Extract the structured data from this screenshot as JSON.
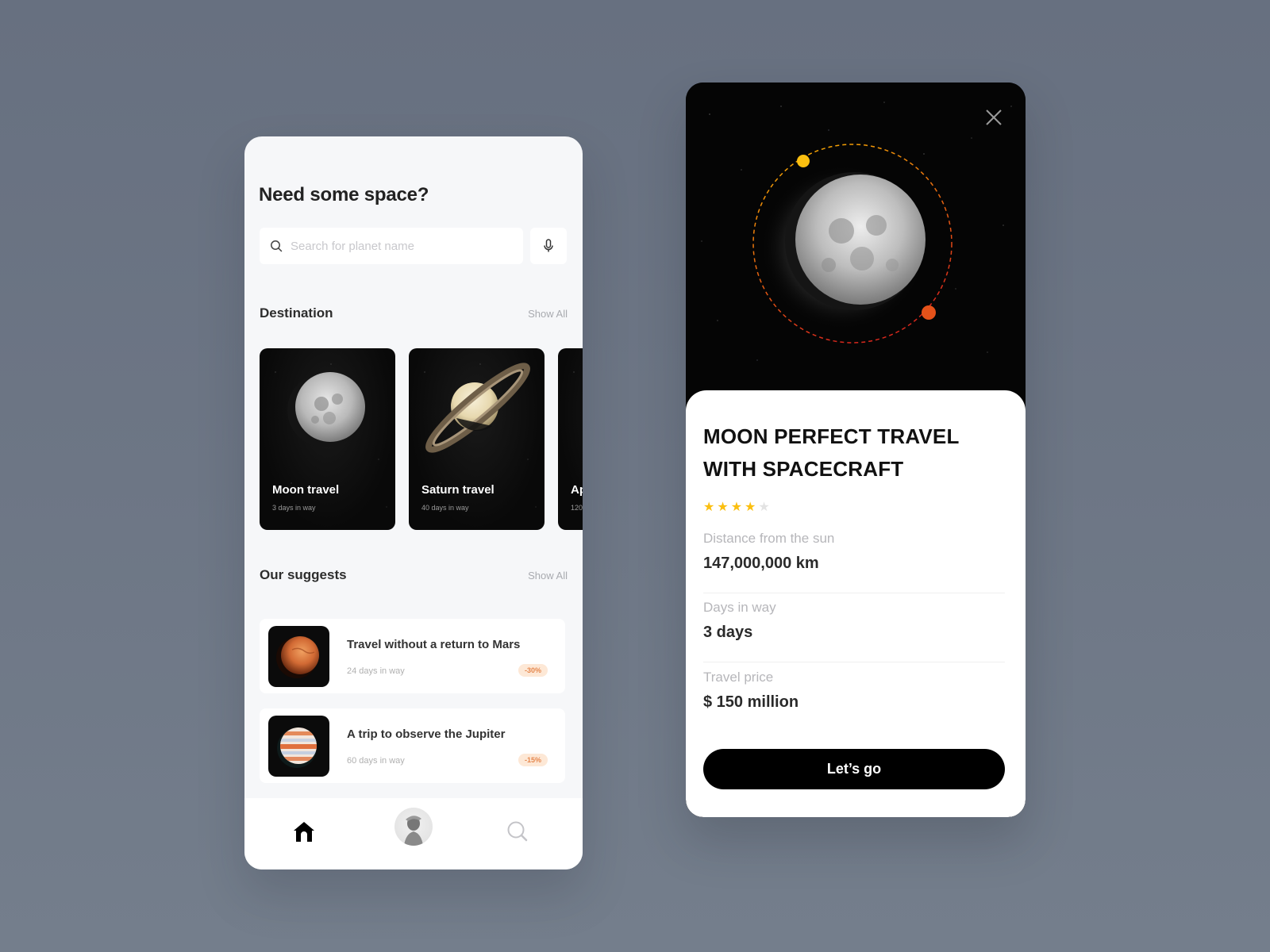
{
  "colors": {
    "background": "#6d7685",
    "star_filled": "#fbbf10",
    "star_empty": "#e3e3e3",
    "badge_bg": "#fde8d6",
    "badge_text": "#e5874e",
    "orbit_start": "#f8b400",
    "orbit_end": "#e0451a"
  },
  "home": {
    "title": "Need some space?",
    "search": {
      "placeholder": "Search for planet name",
      "value": ""
    },
    "icons": {
      "search": "search-icon",
      "mic": "microphone-icon"
    },
    "destination": {
      "heading": "Destination",
      "show_all": "Show All",
      "cards": [
        {
          "name": "Moon travel",
          "sub": "3 days in way",
          "image": "moon"
        },
        {
          "name": "Saturn travel",
          "sub": "40 days in way",
          "image": "saturn"
        },
        {
          "name": "Ap",
          "sub": "120",
          "image": "planet"
        }
      ]
    },
    "suggests": {
      "heading": "Our suggests",
      "show_all": "Show All",
      "items": [
        {
          "title": "Travel without a return to Mars",
          "sub": "24 days in way",
          "badge": "-30%",
          "image": "mars"
        },
        {
          "title": "A trip to observe the Jupiter",
          "sub": "60 days in way",
          "badge": "-15%",
          "image": "jupiter"
        }
      ]
    },
    "tabbar": {
      "items": [
        {
          "name": "home",
          "icon": "home-icon",
          "active": true
        },
        {
          "name": "profile",
          "icon": "avatar",
          "active": false
        },
        {
          "name": "search",
          "icon": "search-icon",
          "active": false
        }
      ]
    }
  },
  "detail": {
    "close_icon": "close-icon",
    "title": "MOON PERFECT TRAVEL WITH SPACECRAFT",
    "rating": {
      "value": 4,
      "max": 5
    },
    "fields": [
      {
        "label": "Distance from the sun",
        "value": "147,000,000 km"
      },
      {
        "label": "Days in way",
        "value": "3 days"
      },
      {
        "label": "Travel price",
        "value": "$ 150 million"
      }
    ],
    "cta": "Let’s go"
  }
}
